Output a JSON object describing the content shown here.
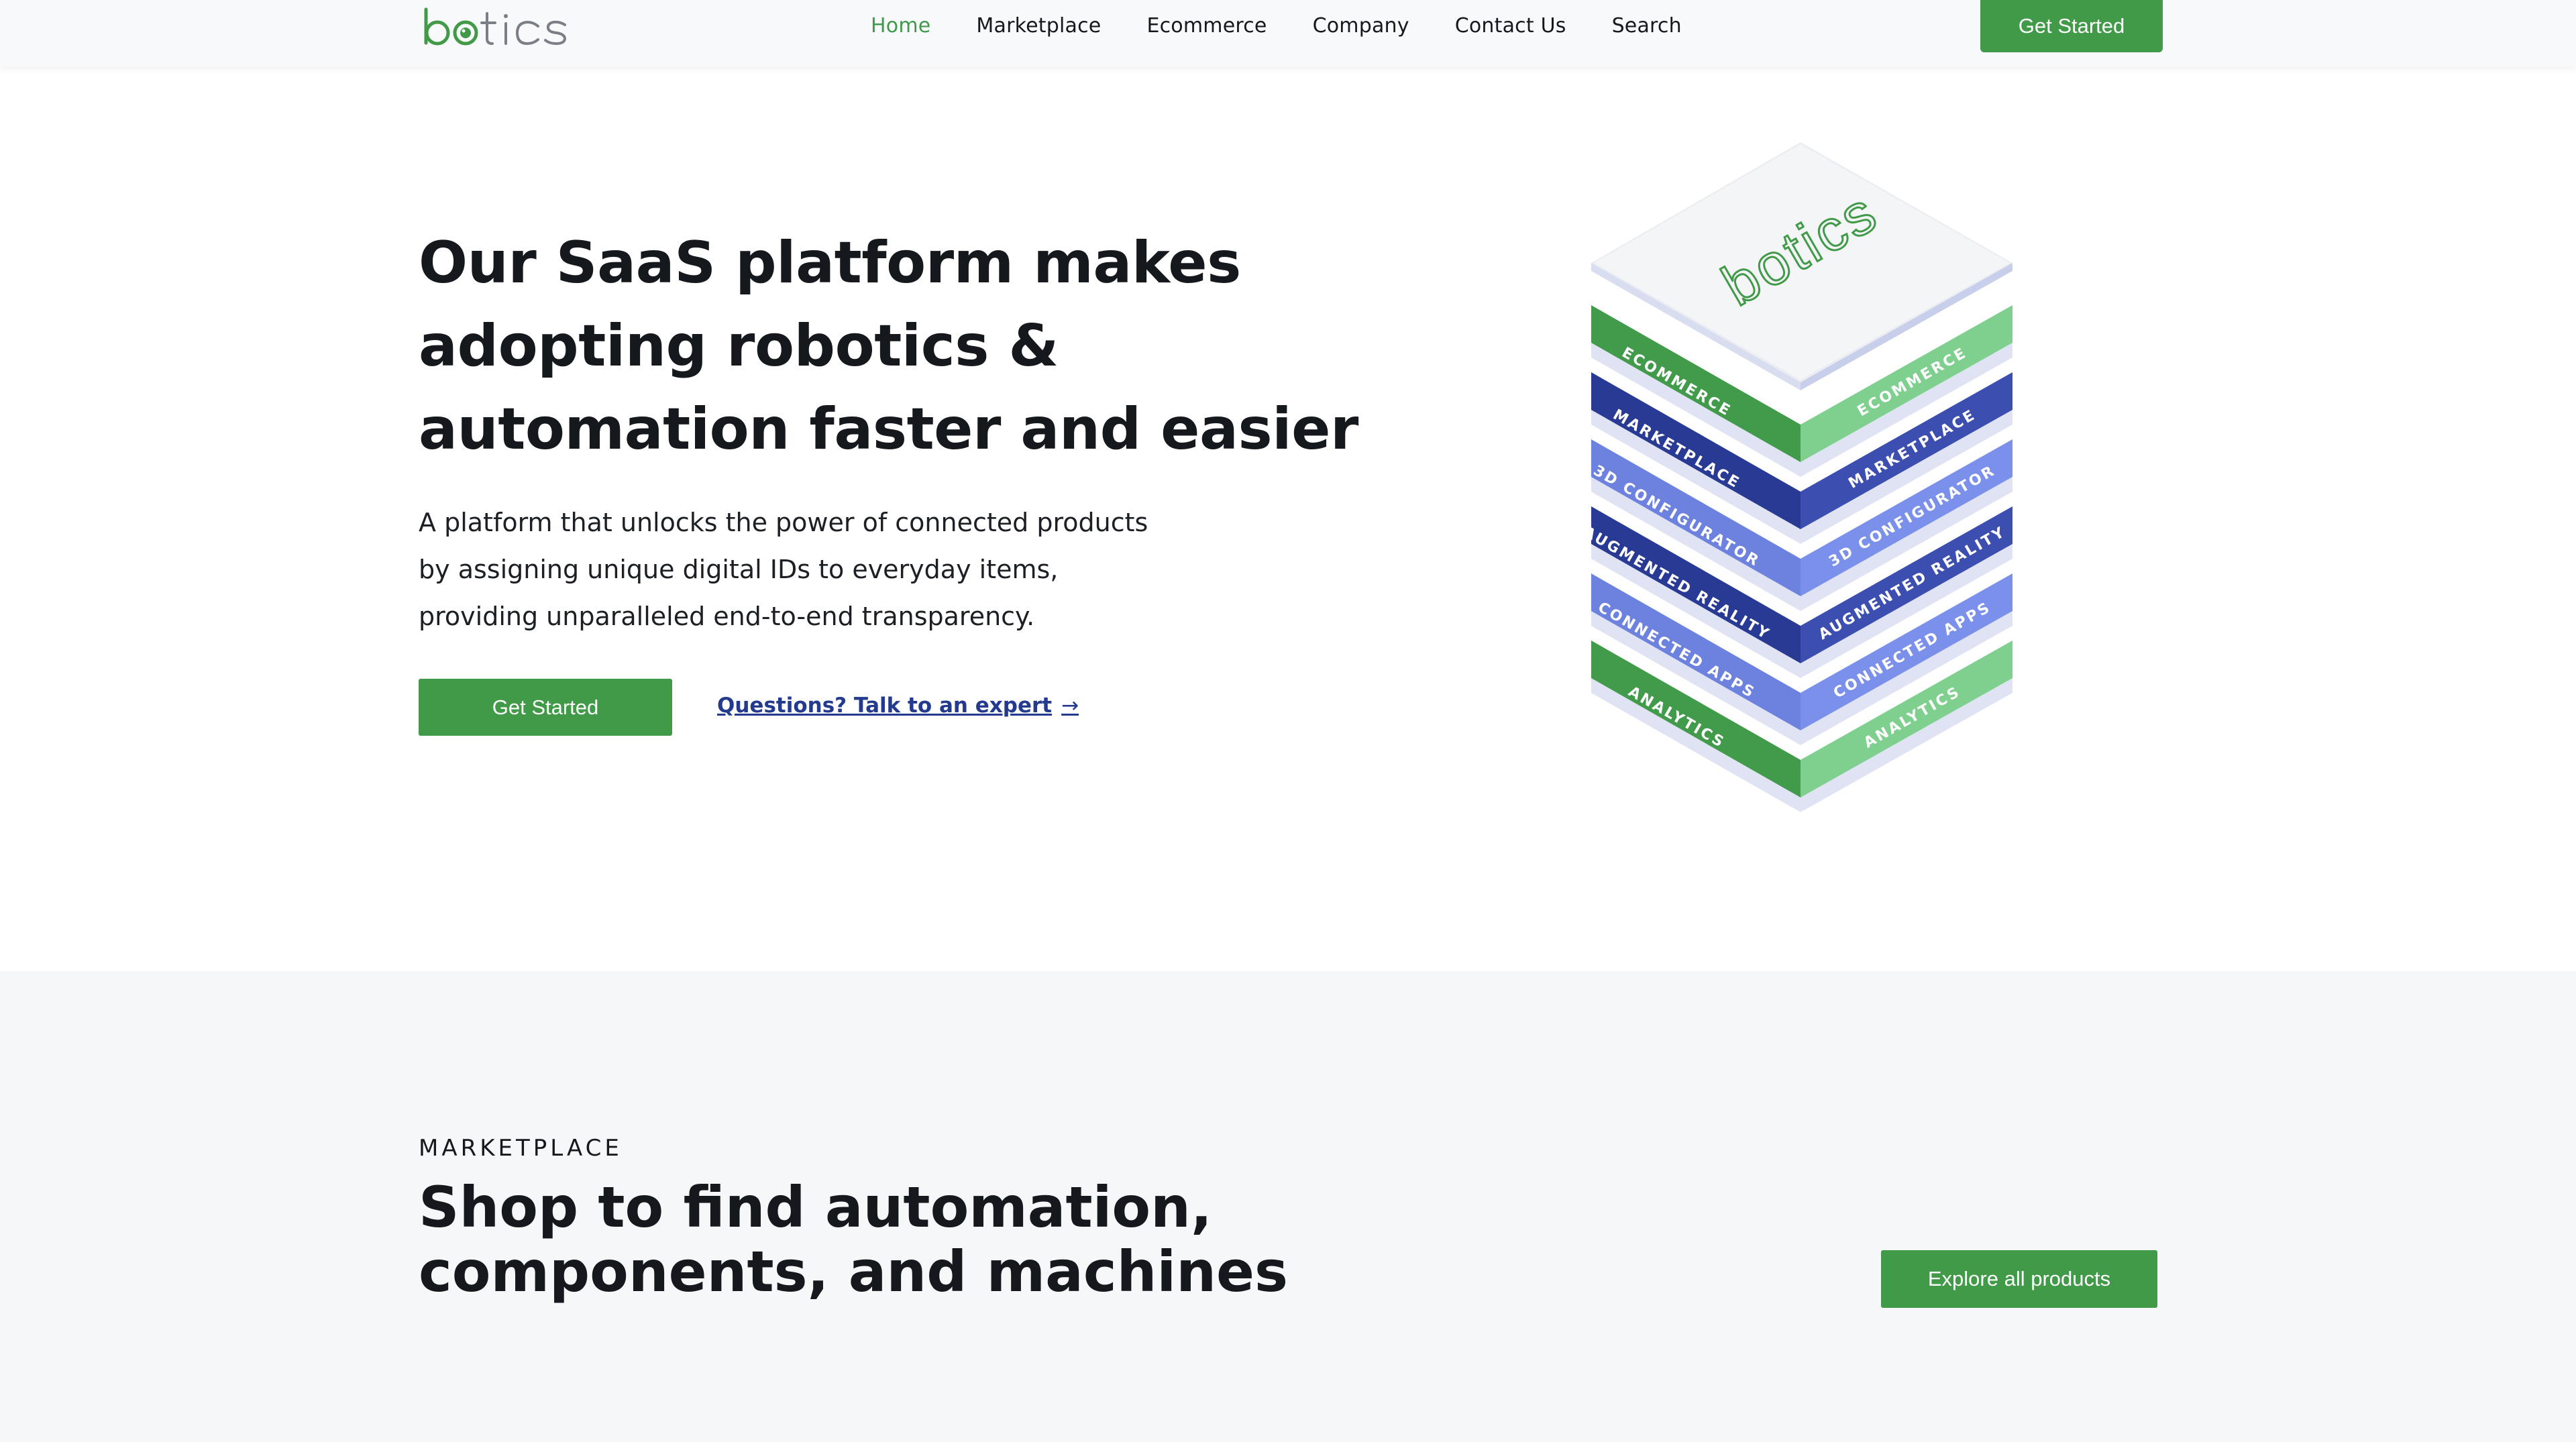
{
  "brand": {
    "name": "botics",
    "colors": {
      "green": "#409a48",
      "light_green": "#7ccd8e",
      "navy": "#283a93",
      "periwinkle": "#6b80dd"
    }
  },
  "nav": {
    "links": [
      "Home",
      "Marketplace",
      "Ecommerce",
      "Company",
      "Contact Us",
      "Search"
    ],
    "active": "Home",
    "cta_label": "Get Started"
  },
  "hero": {
    "title": "Our SaaS platform makes adopting robotics & automation faster and easier",
    "description": "A platform that unlocks the power of connected products by assigning unique digital IDs to everyday items, providing unparalleled end-to-end transparency.",
    "cta_label": "Get Started",
    "expert_link": "Questions? Talk to an expert",
    "arrow_glyph": "→"
  },
  "stack": {
    "top_label": "botics",
    "layers": [
      "Ecommerce",
      "Marketplace",
      "3D Configurator",
      "Augmented Reality",
      "Connected Apps",
      "Analytics"
    ]
  },
  "marketplace": {
    "eyebrow": "MARKETPLACE",
    "title": "Shop to find automation, components, and machines",
    "cta_label": "Explore all products"
  }
}
